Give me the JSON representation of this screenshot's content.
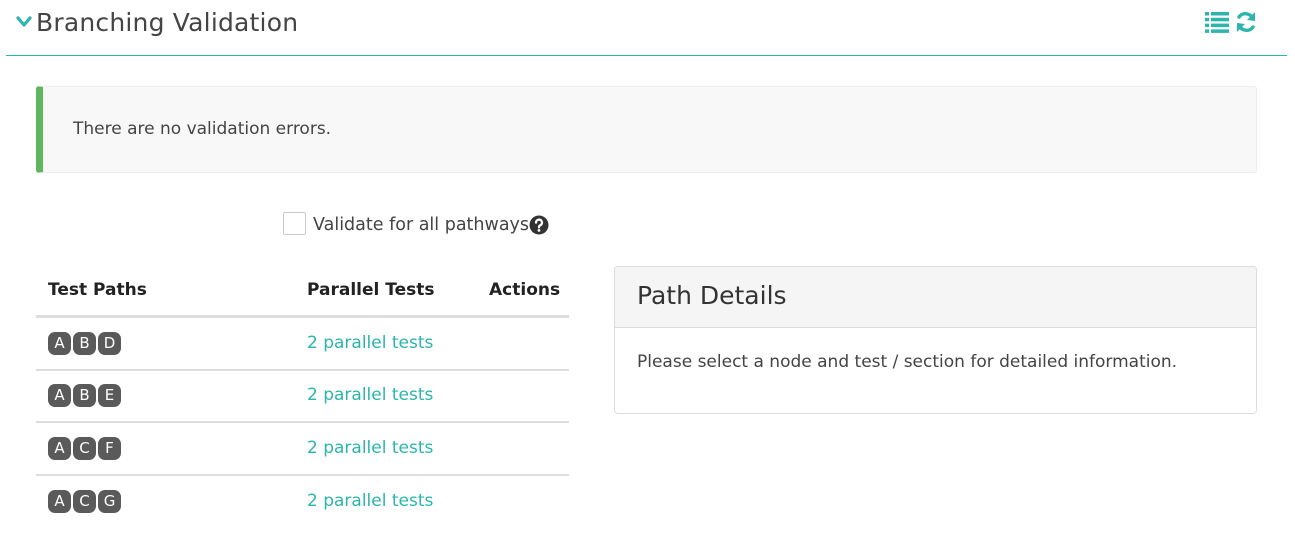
{
  "header": {
    "title": "Branching Validation",
    "collapse_icon": "chevron-down-icon",
    "list_icon": "list-icon",
    "refresh_icon": "refresh-icon",
    "accent_color": "#2bb5ad"
  },
  "alert": {
    "text": "There are no validation errors.",
    "status_color": "#5cb85c"
  },
  "validate": {
    "label": "Validate for all pathways",
    "checked": false,
    "help_icon": "question-circle-icon"
  },
  "table": {
    "headers": {
      "paths": "Test Paths",
      "parallel": "Parallel Tests",
      "actions": "Actions"
    },
    "rows": [
      {
        "nodes": [
          "A",
          "B",
          "D"
        ],
        "parallel": "2 parallel tests"
      },
      {
        "nodes": [
          "A",
          "B",
          "E"
        ],
        "parallel": "2 parallel tests"
      },
      {
        "nodes": [
          "A",
          "C",
          "F"
        ],
        "parallel": "2 parallel tests"
      },
      {
        "nodes": [
          "A",
          "C",
          "G"
        ],
        "parallel": "2 parallel tests"
      }
    ]
  },
  "details": {
    "title": "Path Details",
    "text": "Please select a node and test / section for detailed information."
  }
}
